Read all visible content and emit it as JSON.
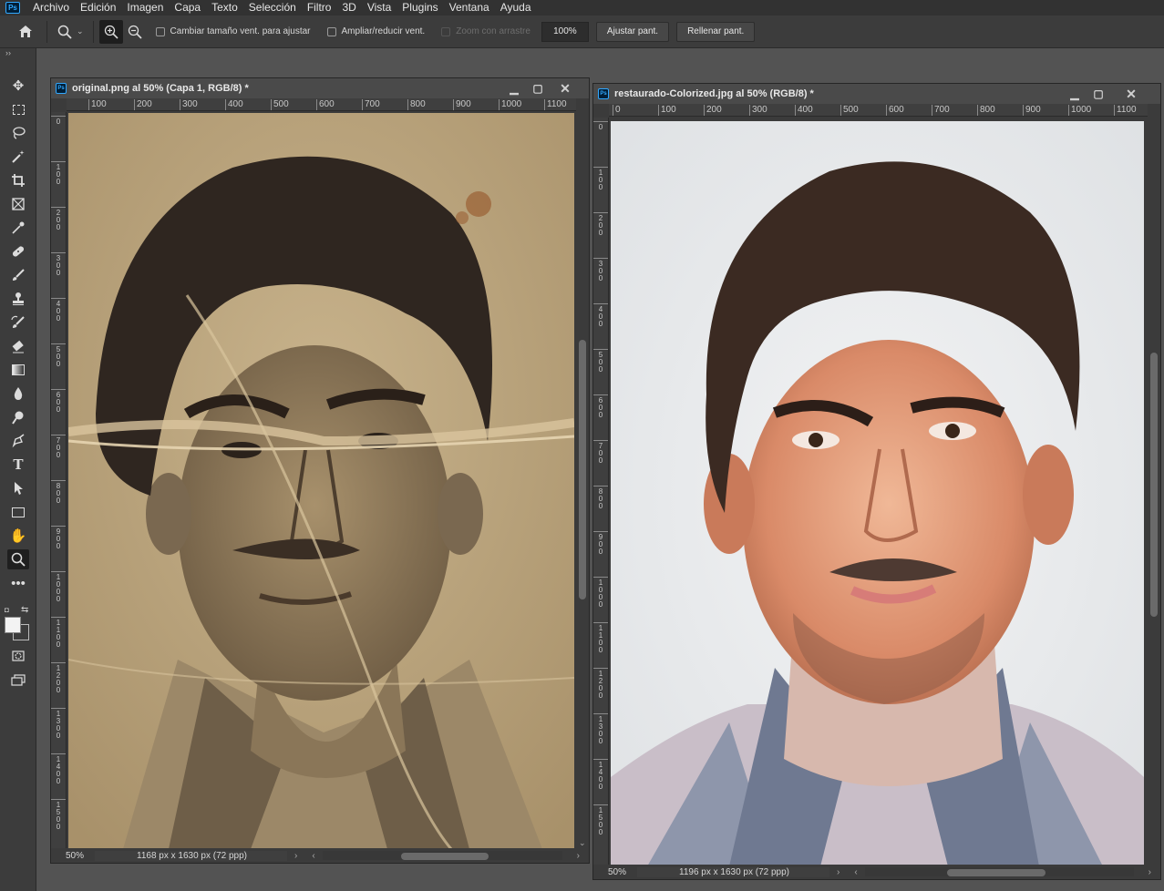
{
  "app": {
    "menu": [
      "Archivo",
      "Edición",
      "Imagen",
      "Capa",
      "Texto",
      "Selección",
      "Filtro",
      "3D",
      "Vista",
      "Plugins",
      "Ventana",
      "Ayuda"
    ],
    "logo": "Ps"
  },
  "options": {
    "resize_windows": "Cambiar tamaño vent. para ajustar",
    "zoom_all_windows": "Ampliar/reducir vent.",
    "scrubby_zoom": "Zoom con arrastre",
    "zoom_value": "100%",
    "fit_screen": "Ajustar pant.",
    "fill_screen": "Rellenar pant."
  },
  "documents": [
    {
      "title": "original.png al 50% (Capa 1, RGB/8) *",
      "zoom": "50%",
      "info": "1168 px x 1630 px (72 ppp)",
      "ruler_h": [
        "100",
        "200",
        "300",
        "400",
        "500",
        "600",
        "700",
        "800",
        "900",
        "1000",
        "1100"
      ],
      "ruler_v": [
        "0",
        "100",
        "200",
        "300",
        "400",
        "500",
        "600",
        "700",
        "800",
        "900",
        "1000",
        "1100",
        "1200",
        "1300",
        "1400",
        "1500"
      ],
      "photo": "sepia damaged portrait"
    },
    {
      "title": "restaurado-Colorized.jpg al 50% (RGB/8) *",
      "zoom": "50%",
      "info": "1196 px x 1630 px (72 ppp)",
      "ruler_h": [
        "0",
        "100",
        "200",
        "300",
        "400",
        "500",
        "600",
        "700",
        "800",
        "900",
        "1000",
        "1100"
      ],
      "ruler_v": [
        "0",
        "100",
        "200",
        "300",
        "400",
        "500",
        "600",
        "700",
        "800",
        "900",
        "1000",
        "1100",
        "1200",
        "1300",
        "1400",
        "1500"
      ],
      "photo": "colorized restored portrait"
    }
  ],
  "colors": {
    "foreground": "#f3f3f3",
    "background": "#3c3c3c",
    "accent": "#31a8ff"
  }
}
